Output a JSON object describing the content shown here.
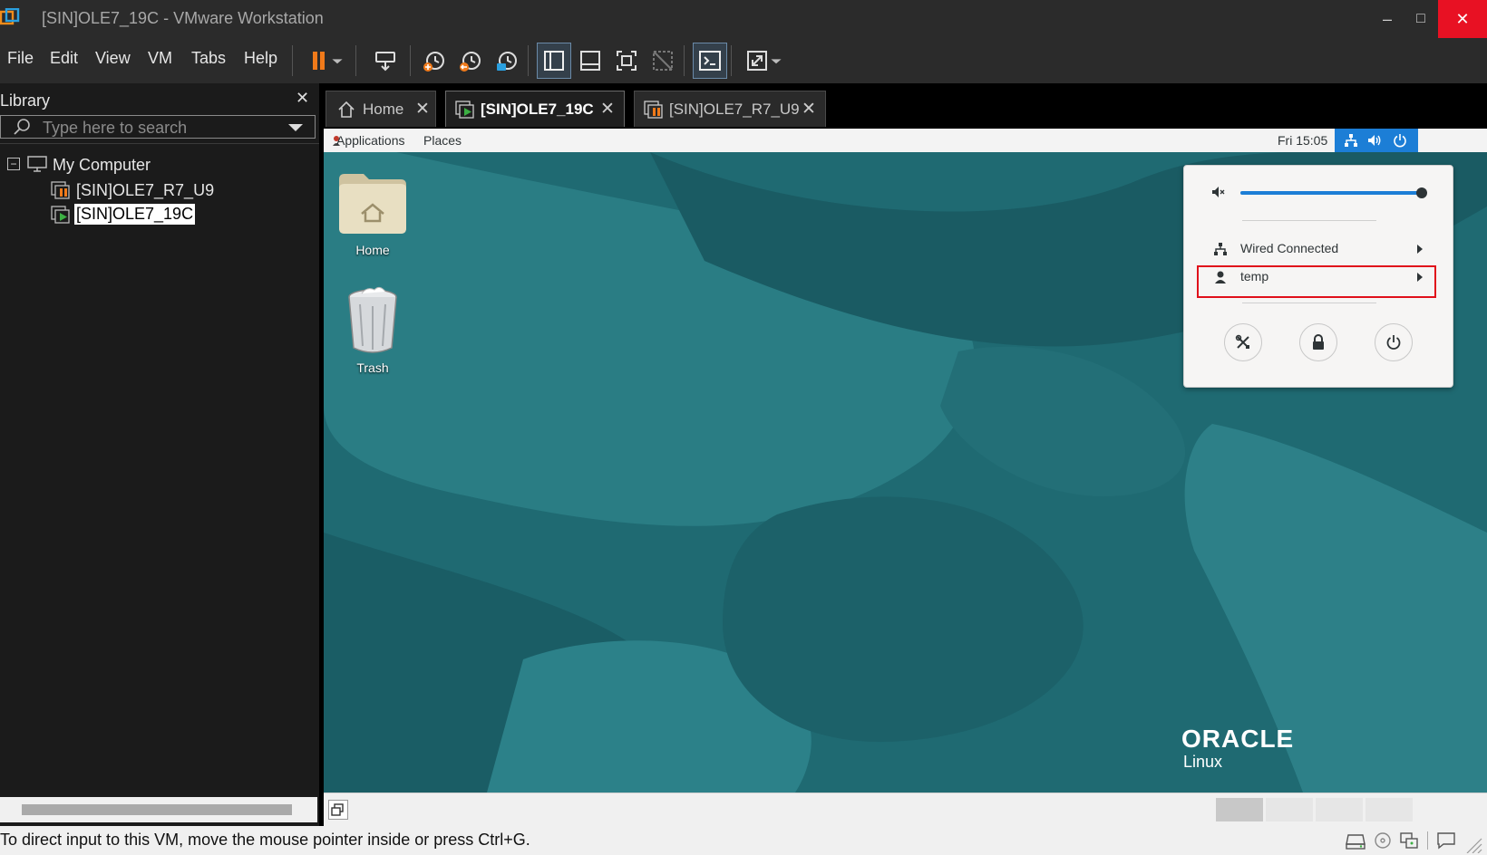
{
  "window": {
    "title": "[SIN]OLE7_19C - VMware Workstation",
    "min_glyph": "–",
    "max_glyph": "□",
    "close_glyph": "✕"
  },
  "menu": {
    "items": [
      "File",
      "Edit",
      "View",
      "VM",
      "Tabs",
      "Help"
    ]
  },
  "library": {
    "title": "Library",
    "close_glyph": "✕",
    "search_placeholder": "Type here to search",
    "tree": {
      "root_label": "My Computer",
      "expander": "−",
      "children": [
        {
          "label": "[SIN]OLE7_R7_U9",
          "state": "suspended"
        },
        {
          "label": "[SIN]OLE7_19C",
          "state": "running",
          "selected": true
        }
      ]
    }
  },
  "tabs": [
    {
      "label": "Home",
      "icon": "home-icon"
    },
    {
      "label": "[SIN]OLE7_19C",
      "icon": "vm-running-icon",
      "active": true
    },
    {
      "label": "[SIN]OLE7_R7_U9",
      "icon": "vm-suspended-icon"
    }
  ],
  "tab_close_glyph": "✕",
  "guest": {
    "topbar": {
      "applications": "Applications",
      "places": "Places",
      "clock": "Fri 15:05"
    },
    "desktop_icons": [
      {
        "label": "Home",
        "icon": "folder-home-icon"
      },
      {
        "label": "Trash",
        "icon": "trash-icon"
      }
    ],
    "popup": {
      "volume_level": 1.0,
      "wired_label": "Wired Connected",
      "user_label": "temp",
      "buttons": [
        "settings-icon",
        "lock-icon",
        "power-icon"
      ]
    },
    "brand": {
      "logo_text": "ORACLE",
      "sub_text": "Linux"
    }
  },
  "status": {
    "text": "To direct input to this VM, move the mouse pointer inside or press Ctrl+G."
  },
  "colors": {
    "desktop": "#1f6a72",
    "accent_blue": "#1c7ed6",
    "pause_orange": "#f07a1a",
    "highlight_red": "#e0101a",
    "close_red": "#e81123"
  }
}
